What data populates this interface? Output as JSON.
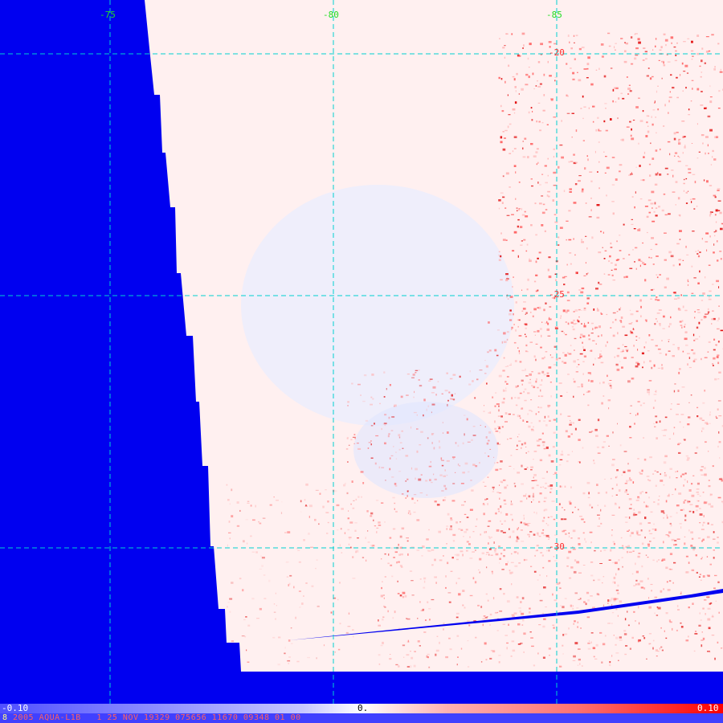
{
  "map": {
    "longitude_labels": [
      "-75",
      "-80",
      "-85"
    ],
    "latitude_labels": [
      "-20",
      "-25",
      "-30"
    ],
    "colors": {
      "background": "#0000f0",
      "graticule": "#00d0d0",
      "longitude_label": "#22dd22",
      "latitude_label": "#ff3030",
      "swath_base": "#fff0f0",
      "positive": "#ff0000",
      "negative": "#5050ff"
    }
  },
  "colorbar": {
    "min_label": "-0.10",
    "mid_label": "0.",
    "max_label": "0.10"
  },
  "info_bar": {
    "leading": "8",
    "text": "2005 AQUA-L1B   1 25 NOV 19329 075656 11670 09348 01 00"
  }
}
